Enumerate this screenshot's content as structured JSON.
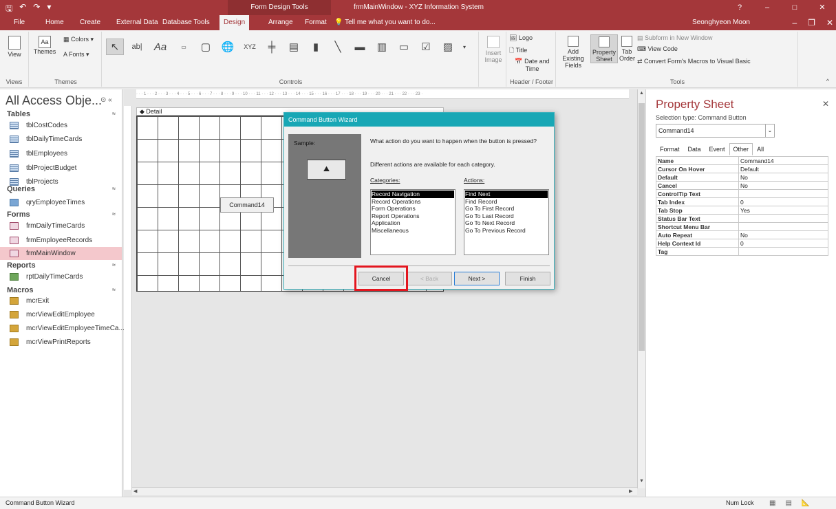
{
  "titlebar": {
    "context_tab": "Form Design Tools",
    "title": "frmMainWindow - XYZ Information System",
    "help": "?",
    "minimize": "–",
    "restore": "□",
    "close": "✕"
  },
  "tabs": [
    "File",
    "Home",
    "Create",
    "External Data",
    "Database Tools",
    "Design",
    "Arrange",
    "Format"
  ],
  "tell_me": "Tell me what you want to do...",
  "user": "Seonghyeon Moon",
  "ribbon": {
    "view_label": "View",
    "views_group": "Views",
    "themes_label": "Themes",
    "colors_label": "Colors",
    "fonts_label": "Fonts",
    "themes_group": "Themes",
    "controls_group": "Controls",
    "insert_image": "Insert Image",
    "logo": "Logo",
    "title": "Title",
    "date_time": "Date and Time",
    "header_footer_group": "Header / Footer",
    "add_existing_fields": "Add Existing Fields",
    "property_sheet": "Property Sheet",
    "tab_order": "Tab Order",
    "subform": "Subform in New Window",
    "view_code": "View Code",
    "convert_macros": "Convert Form's Macros to Visual Basic",
    "tools_group": "Tools"
  },
  "nav": {
    "title": "All Access Obje...",
    "sections": [
      {
        "label": "Tables",
        "items": [
          "tblCostCodes",
          "tblDailyTimeCards",
          "tblEmployees",
          "tblProjectBudget",
          "tblProjects"
        ]
      },
      {
        "label": "Queries",
        "items": [
          "qryEmployeeTimes"
        ]
      },
      {
        "label": "Forms",
        "items": [
          "frmDailyTimeCards",
          "frmEmployeeRecords",
          "frmMainWindow"
        ]
      },
      {
        "label": "Reports",
        "items": [
          "rptDailyTimeCards"
        ]
      },
      {
        "label": "Macros",
        "items": [
          "mcrExit",
          "mcrViewEditEmployee",
          "mcrViewEditEmployeeTimeCa...",
          "mcrViewPrintReports"
        ]
      }
    ]
  },
  "design": {
    "detail_label": "Detail",
    "button_caption": "Command14"
  },
  "wizard": {
    "title": "Command Button Wizard",
    "sample_label": "Sample:",
    "question": "What action do you want to happen when the button is pressed?",
    "hint": "Different actions are available for each category.",
    "categories_label": "Categories:",
    "actions_label": "Actions:",
    "categories": [
      "Record Navigation",
      "Record Operations",
      "Form Operations",
      "Report Operations",
      "Application",
      "Miscellaneous"
    ],
    "actions": [
      "Find Next",
      "Find Record",
      "Go To First Record",
      "Go To Last Record",
      "Go To Next Record",
      "Go To Previous Record"
    ],
    "cancel": "Cancel",
    "back": "< Back",
    "next": "Next >",
    "finish": "Finish"
  },
  "property_sheet": {
    "title": "Property Sheet",
    "selection_type": "Selection type:  Command Button",
    "selected": "Command14",
    "tabs": [
      "Format",
      "Data",
      "Event",
      "Other",
      "All"
    ],
    "rows": [
      [
        "Name",
        "Command14"
      ],
      [
        "Cursor On Hover",
        "Default"
      ],
      [
        "Default",
        "No"
      ],
      [
        "Cancel",
        "No"
      ],
      [
        "ControlTip Text",
        ""
      ],
      [
        "Tab Index",
        "0"
      ],
      [
        "Tab Stop",
        "Yes"
      ],
      [
        "Status Bar Text",
        ""
      ],
      [
        "Shortcut Menu Bar",
        ""
      ],
      [
        "Auto Repeat",
        "No"
      ],
      [
        "Help Context Id",
        "0"
      ],
      [
        "Tag",
        ""
      ]
    ]
  },
  "status": {
    "left": "Command Button Wizard",
    "num_lock": "Num Lock"
  },
  "colors": {
    "accent": "#a4373a",
    "dialog_title": "#18a7b5",
    "highlight": "#e3161f",
    "selected_nav": "#f4c8cc"
  }
}
